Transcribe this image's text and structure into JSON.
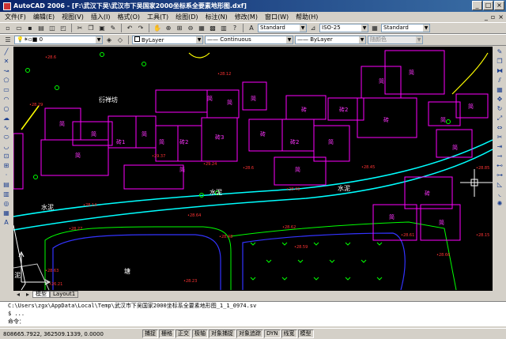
{
  "window": {
    "title": "AutoCAD 2006 - [F:\\武汉下吴\\武汉市下吴国家2000坐标系全要素地形图.dxf]"
  },
  "menu": [
    "文件(F)",
    "编辑(E)",
    "视图(V)",
    "插入(I)",
    "格式(O)",
    "工具(T)",
    "绘图(D)",
    "标注(N)",
    "修改(M)",
    "窗口(W)",
    "帮助(H)"
  ],
  "styles": {
    "text_style": "Standard",
    "dim_style": "ISO-25",
    "table_style": "Standard"
  },
  "properties": {
    "layer_color": "ByLayer",
    "linetype": "Continuous",
    "lineweight": "ByLayer",
    "plot_style": "随颜色"
  },
  "map_labels": {
    "tile_roof_1": "衍禅坊",
    "cement_1": "水泥",
    "cement_2": "水泥",
    "cement_3": "水泥",
    "pond": "塘",
    "mud": "泥"
  },
  "buildings": [
    "简",
    "简",
    "简",
    "简",
    "砖1",
    "简",
    "砖2",
    "简",
    "砖2",
    "简",
    "砖3",
    "简",
    "砖",
    "砖2",
    "砖",
    "简",
    "简",
    "简",
    "简",
    "砖",
    "简",
    "简",
    "简",
    "简",
    "砖",
    "简",
    "简"
  ],
  "tabs": [
    "模型",
    "Layout1"
  ],
  "command_lines": [
    "C:\\Users\\zgx\\AppData\\Local\\Temp\\武汉市下吴国家2000坐标系全要素地形图_1_1_0974.sv",
    "$ ...",
    "命令："
  ],
  "status": {
    "coords": "808665.7922, 362509.1339, 0.0000",
    "toggles": [
      "捕捉",
      "栅格",
      "正交",
      "极轴",
      "对象捕捉",
      "对象追踪",
      "DYN",
      "线宽",
      "模型"
    ]
  }
}
